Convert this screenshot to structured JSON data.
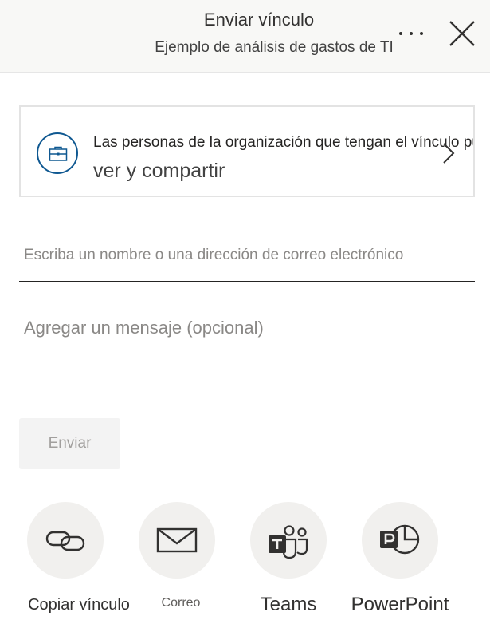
{
  "header": {
    "title": "Enviar vínculo",
    "subtitle": "Ejemplo de análisis de gastos de TI",
    "more_icon": "more-horizontal-icon",
    "close_icon": "close-icon"
  },
  "permission": {
    "icon": "briefcase-icon",
    "line1": "Las personas de la organización que tengan el vínculo pueden",
    "line2": "ver y compartir",
    "chevron_icon": "chevron-right-icon"
  },
  "recipient": {
    "value": "",
    "placeholder": "Escriba un nombre o una dirección de correo electrónico"
  },
  "message": {
    "value": "",
    "placeholder": "Agregar un mensaje (opcional)"
  },
  "send_button": {
    "label": "Enviar"
  },
  "share_options": [
    {
      "label": "Copiar vínculo",
      "icon": "link-icon"
    },
    {
      "label": "Correo",
      "icon": "mail-icon"
    },
    {
      "label": "Teams",
      "icon": "teams-icon"
    },
    {
      "label": "PowerPoint",
      "icon": "powerpoint-icon"
    }
  ],
  "colors": {
    "header_bg": "#f8f8f6",
    "accent": "#0f5891",
    "button_disabled_bg": "#f3f3f3",
    "option_circle_bg": "#f1f0ee"
  }
}
